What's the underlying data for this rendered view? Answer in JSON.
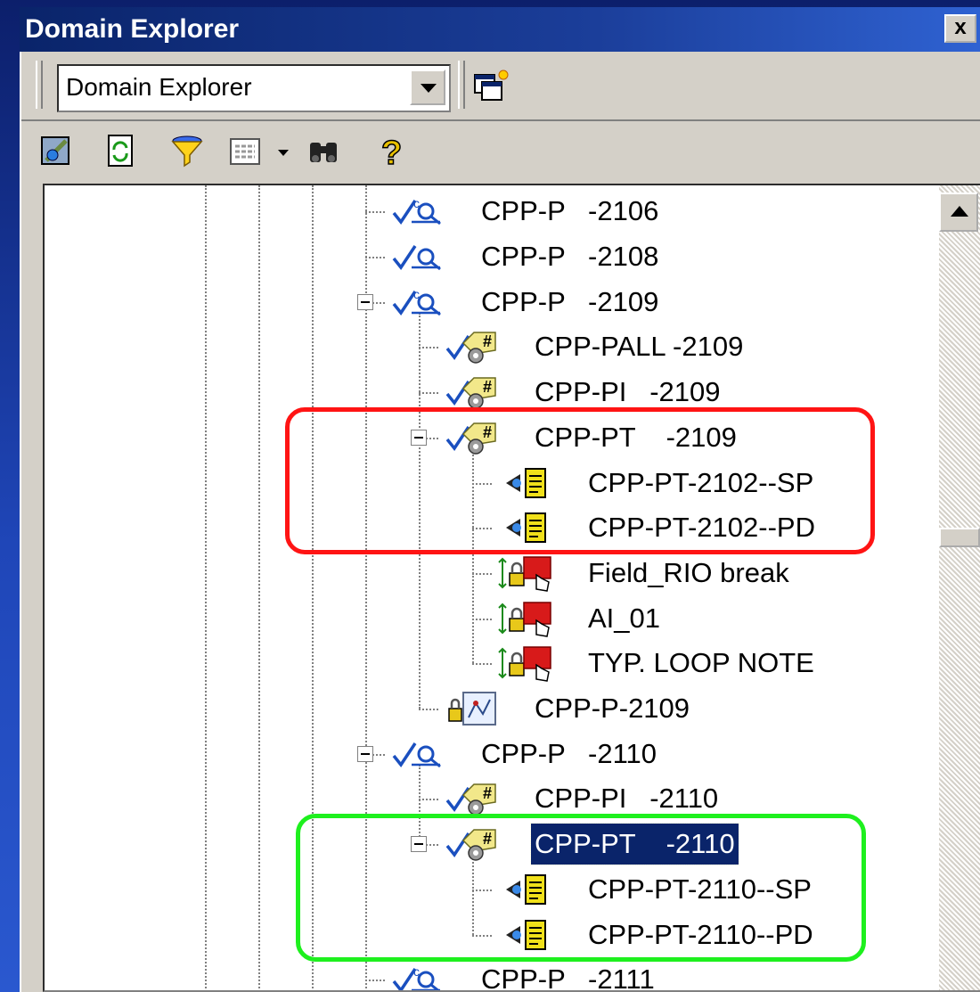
{
  "window": {
    "title": "Domain Explorer",
    "close_glyph": "x"
  },
  "toolbar": {
    "combo_value": "Domain Explorer",
    "icons": [
      "navigate-icon",
      "refresh-icon",
      "filter-icon",
      "view-icon",
      "find-icon",
      "help-icon"
    ]
  },
  "tree": {
    "items": [
      {
        "label": "CPP-P   -2106",
        "kind": "loop",
        "level": 3,
        "sup": "c"
      },
      {
        "label": "CPP-P   -2108",
        "kind": "loop",
        "level": 3
      },
      {
        "label": "CPP-P   -2109",
        "kind": "loop",
        "level": 3,
        "expanded": true,
        "sup": "c"
      },
      {
        "label": "CPP-PALL -2109",
        "kind": "tag",
        "level": 4
      },
      {
        "label": "CPP-PI   -2109",
        "kind": "tag",
        "level": 4
      },
      {
        "label": "CPP-PT    -2109",
        "kind": "tag",
        "level": 4,
        "expanded": true
      },
      {
        "label": "CPP-PT-2102--SP",
        "kind": "doc",
        "level": 5
      },
      {
        "label": "CPP-PT-2102--PD",
        "kind": "doc",
        "level": 5
      },
      {
        "label": "Field_RIO break",
        "kind": "block",
        "level": 5
      },
      {
        "label": "AI_01",
        "kind": "block",
        "level": 5
      },
      {
        "label": "TYP. LOOP NOTE",
        "kind": "block",
        "level": 5
      },
      {
        "label": "CPP-P-2109",
        "kind": "drawing",
        "level": 4
      },
      {
        "label": "CPP-P   -2110",
        "kind": "loop",
        "level": 3,
        "expanded": true
      },
      {
        "label": "CPP-PI   -2110",
        "kind": "tag",
        "level": 4
      },
      {
        "label": "CPP-PT    -2110",
        "kind": "tag",
        "level": 4,
        "expanded": true,
        "selected": true
      },
      {
        "label": "CPP-PT-2110--SP",
        "kind": "doc",
        "level": 5
      },
      {
        "label": "CPP-PT-2110--PD",
        "kind": "doc",
        "level": 5
      },
      {
        "label": "CPP-P   -2111",
        "kind": "loop",
        "level": 3,
        "sup": "c"
      }
    ]
  },
  "highlights": {
    "red_color": "#ff1414",
    "green_color": "#1ef01e"
  },
  "colors": {
    "selection": "#0a246a",
    "title_bar": "#0a246a",
    "face": "#d4d0c8"
  }
}
